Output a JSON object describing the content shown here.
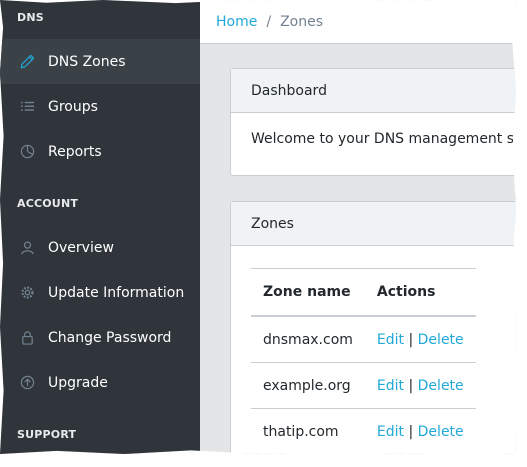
{
  "sidebar": {
    "sections": [
      {
        "title": "DNS"
      },
      {
        "title": "ACCOUNT"
      },
      {
        "title": "SUPPORT"
      }
    ],
    "items": [
      {
        "label": "DNS Zones",
        "icon": "pencil-icon"
      },
      {
        "label": "Groups",
        "icon": "list-icon"
      },
      {
        "label": "Reports",
        "icon": "pie-chart-icon"
      },
      {
        "label": "Overview",
        "icon": "user-icon"
      },
      {
        "label": "Update Information",
        "icon": "gear-icon"
      },
      {
        "label": "Change Password",
        "icon": "lock-icon"
      },
      {
        "label": "Upgrade",
        "icon": "arrow-up-circle-icon"
      }
    ]
  },
  "breadcrumb": {
    "home": "Home",
    "separator": "/",
    "current": "Zones"
  },
  "dashboard": {
    "title": "Dashboard",
    "message": "Welcome to your DNS management site. Fi"
  },
  "zones": {
    "title": "Zones",
    "columns": [
      "Zone name",
      "Actions"
    ],
    "rows": [
      {
        "name": "dnsmax.com",
        "edit": "Edit",
        "sep": "|",
        "delete": "Delete"
      },
      {
        "name": "example.org",
        "edit": "Edit",
        "sep": "|",
        "delete": "Delete"
      },
      {
        "name": "thatip.com",
        "edit": "Edit",
        "sep": "|",
        "delete": "Delete"
      }
    ]
  },
  "colors": {
    "sidebar_bg": "#2f353a",
    "accent": "#20a8d8",
    "page_bg": "#e4e5e6"
  }
}
